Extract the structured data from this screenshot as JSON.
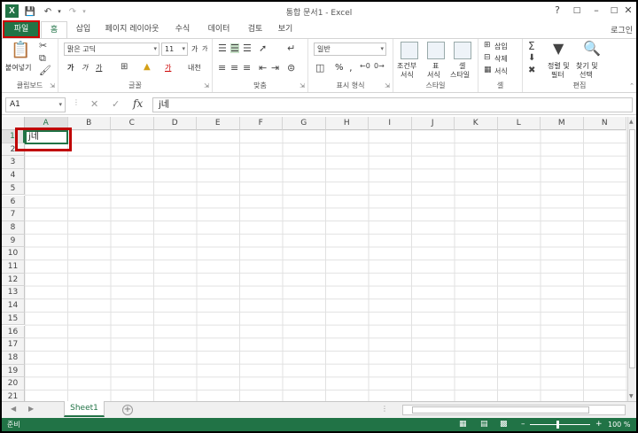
{
  "window": {
    "title": "통합 문서1 - Excel",
    "signin": "로그인"
  },
  "tabs": [
    {
      "label": "파일"
    },
    {
      "label": "홈"
    },
    {
      "label": "삽입"
    },
    {
      "label": "페이지 레이아웃"
    },
    {
      "label": "수식"
    },
    {
      "label": "데이터"
    },
    {
      "label": "검토"
    },
    {
      "label": "보기"
    }
  ],
  "ribbon": {
    "clipboard": {
      "label": "클립보드",
      "paste": "붙여넣기"
    },
    "font": {
      "label": "글꼴",
      "name": "맑은 고딕",
      "size": "11",
      "bold": "가",
      "italic": "가",
      "underline": "가",
      "grow": "가",
      "shrink": "가",
      "phonetic": "내천"
    },
    "alignment": {
      "label": "맞춤"
    },
    "number": {
      "label": "표시 형식",
      "format": "일반",
      "percent": "%"
    },
    "styles": {
      "label": "스타일",
      "conditional": "조건부\n서식",
      "conditional_1": "조건부",
      "conditional_2": "서식",
      "table_1": "표",
      "table_2": "서식",
      "cell_1": "셀",
      "cell_2": "스타일"
    },
    "cells": {
      "label": "셀",
      "insert": "삽입",
      "delete": "삭제",
      "format": "서식"
    },
    "editing": {
      "label": "편집",
      "sort_1": "정렬 및",
      "sort_2": "필터",
      "find_1": "찾기 및",
      "find_2": "선택"
    }
  },
  "formula_bar": {
    "name_box": "A1",
    "fx": "fx",
    "value": "j네"
  },
  "grid": {
    "columns": [
      "A",
      "B",
      "C",
      "D",
      "E",
      "F",
      "G",
      "H",
      "I",
      "J",
      "K",
      "L",
      "M",
      "N"
    ],
    "rows": [
      "1",
      "2",
      "3",
      "4",
      "5",
      "6",
      "7",
      "8",
      "9",
      "10",
      "11",
      "12",
      "13",
      "14",
      "15",
      "16",
      "17",
      "18",
      "19",
      "20",
      "21"
    ],
    "a1_value": "j네"
  },
  "sheets": {
    "active": "Sheet1"
  },
  "status": {
    "ready": "준비",
    "zoom": "100 %"
  },
  "colors": {
    "accent": "#217346",
    "highlight": "#c00000"
  }
}
